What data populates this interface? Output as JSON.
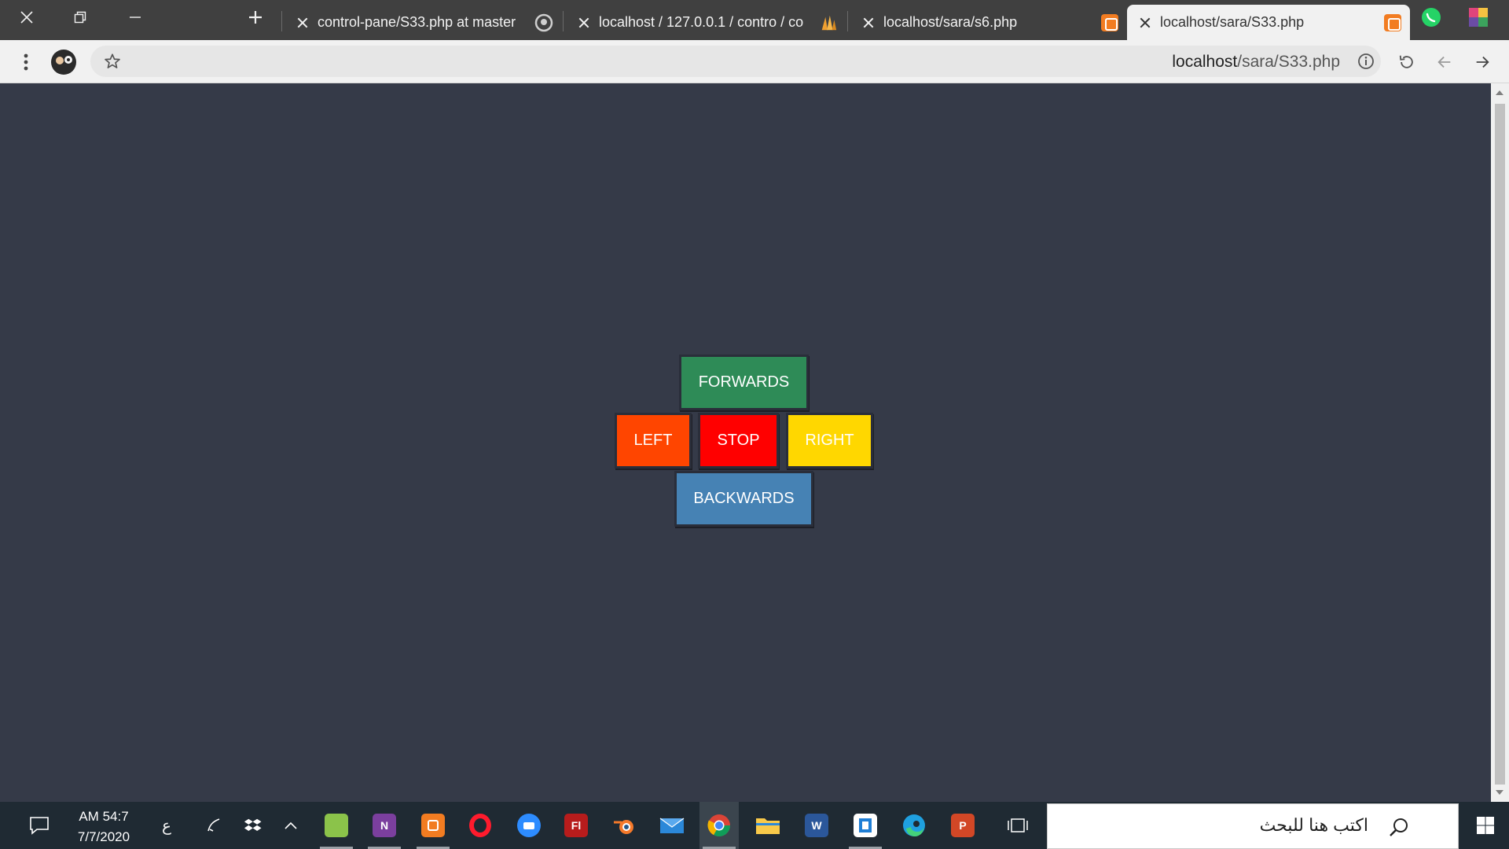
{
  "browser": {
    "tabs": [
      {
        "title": "control-pane/S33.php at master",
        "icon": "github-icon"
      },
      {
        "title": "localhost / 127.0.0.1 / contro / co",
        "icon": "phpmyadmin-icon"
      },
      {
        "title": "localhost/sara/s6.php",
        "icon": "xampp-icon"
      },
      {
        "title": "localhost/sara/S33.php",
        "icon": "xampp-icon",
        "active": true
      }
    ],
    "address": {
      "host": "localhost",
      "path": "/sara/S33.php"
    }
  },
  "controls": {
    "forwards": {
      "label": "FORWARDS",
      "color": "#2e8b57"
    },
    "left": {
      "label": "LEFT",
      "color": "#ff4500"
    },
    "stop": {
      "label": "STOP",
      "color": "#ff0000"
    },
    "right": {
      "label": "RIGHT",
      "color": "#ffd700"
    },
    "backwards": {
      "label": "BACKWARDS",
      "color": "#4682b4"
    }
  },
  "taskbar": {
    "time": "AM 54:7",
    "date": "7/7/2020",
    "language": "ع",
    "search_placeholder": "اكتب هنا للبحث"
  }
}
